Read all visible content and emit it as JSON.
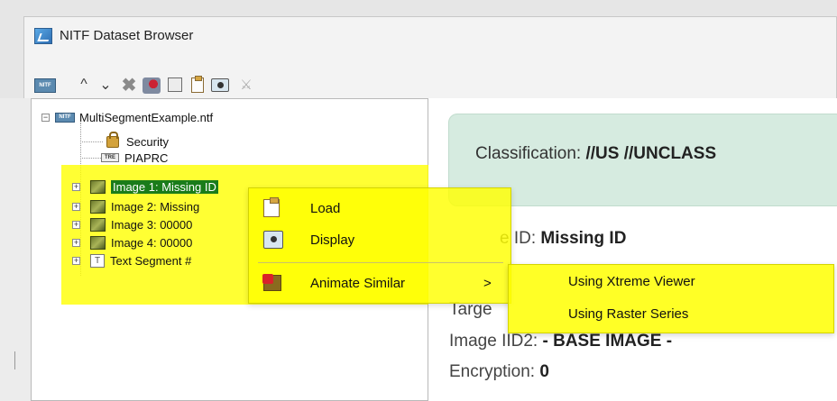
{
  "window": {
    "title": "NITF Dataset Browser",
    "app_icon": "nitf-app-icon"
  },
  "toolbar": {
    "buttons": [
      {
        "name": "nitf-file-icon",
        "label": "NITF"
      },
      {
        "name": "chevron-up-icon",
        "glyph": "^"
      },
      {
        "name": "chevron-down-icon",
        "glyph": "⌄"
      },
      {
        "name": "delete-icon",
        "glyph": "✖"
      },
      {
        "name": "tools-icon",
        "glyph": ""
      },
      {
        "name": "properties-icon",
        "glyph": ""
      },
      {
        "name": "clipboard-icon",
        "glyph": ""
      },
      {
        "name": "display-icon",
        "glyph": ""
      },
      {
        "name": "wand-icon",
        "glyph": "⚔"
      }
    ]
  },
  "tree": {
    "root": {
      "label": "MultiSegmentExample.ntf",
      "icon": "nitf-file-icon",
      "badge": "NITF"
    },
    "children": [
      {
        "label": "Security",
        "icon": "lock-icon"
      },
      {
        "label": "PIAPRC",
        "icon": "tre-icon",
        "badge": "TRE"
      },
      {
        "label": "Image 1: Missing ID",
        "icon": "image-icon",
        "selected": true
      },
      {
        "label": "Image 2: Missing",
        "icon": "image-icon"
      },
      {
        "label": "Image 3: 00000",
        "icon": "image-icon"
      },
      {
        "label": "Image 4: 00000",
        "icon": "image-icon"
      },
      {
        "label": "Text Segment #",
        "icon": "text-segment-icon"
      }
    ]
  },
  "details": {
    "classification_label": "Classification: ",
    "classification_value": "//US //UNCLASS",
    "image_id_label": "e ID: ",
    "image_id_value": "Missing ID",
    "target_label": "Targe",
    "image_iid2_label": "Image IID2: ",
    "image_iid2_value": "- BASE IMAGE -",
    "encryption_label": "Encryption: ",
    "encryption_value": "0"
  },
  "context_menu": {
    "items": [
      {
        "label": "Load",
        "icon": "load-icon"
      },
      {
        "label": "Display",
        "icon": "display-icon"
      },
      {
        "label": "Animate Similar",
        "icon": "animate-icon",
        "arrow": ">"
      }
    ]
  },
  "submenu": {
    "items": [
      {
        "label": "Using Xtreme Viewer"
      },
      {
        "label": "Using Raster Series"
      }
    ]
  },
  "colors": {
    "highlight": "#ffff00",
    "selection": "#1a7c1a",
    "classification_bg": "#d6ebe0"
  }
}
